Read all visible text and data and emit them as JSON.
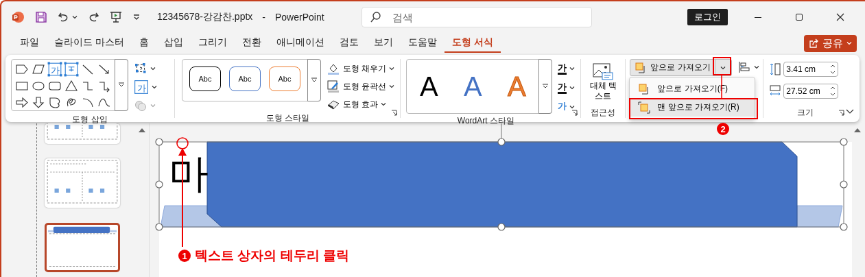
{
  "title_bar": {
    "file_name": "12345678-강감찬.pptx",
    "separator": "-",
    "app_name": "PowerPoint",
    "search": {
      "placeholder": "검색"
    },
    "login": "로그인"
  },
  "tabs": [
    {
      "label": "파일",
      "selected": false
    },
    {
      "label": "슬라이드 마스터",
      "selected": false
    },
    {
      "label": "홈",
      "selected": false
    },
    {
      "label": "삽입",
      "selected": false
    },
    {
      "label": "그리기",
      "selected": false
    },
    {
      "label": "전환",
      "selected": false
    },
    {
      "label": "애니메이션",
      "selected": false
    },
    {
      "label": "검토",
      "selected": false
    },
    {
      "label": "보기",
      "selected": false
    },
    {
      "label": "도움말",
      "selected": false
    },
    {
      "label": "도형 서식",
      "selected": true
    }
  ],
  "share_button": {
    "label": "공유"
  },
  "ribbon": {
    "shape_insert": {
      "label": "도형 삽입",
      "text_box_glyph": "가",
      "edit_glyph": "가"
    },
    "shape_styles": {
      "label": "도형 스타일",
      "presets": [
        {
          "text": "Abc",
          "color": "#000000"
        },
        {
          "text": "Abc",
          "color": "#4472c4"
        },
        {
          "text": "Abc",
          "color": "#ed7d31"
        }
      ],
      "commands": [
        {
          "label": "도형 채우기"
        },
        {
          "label": "도형 윤곽선"
        },
        {
          "label": "도형 효과"
        }
      ]
    },
    "wordart_styles": {
      "label": "WordArt 스타일",
      "presets": [
        {
          "text": "A",
          "color": "#000000"
        },
        {
          "text": "A",
          "color": "#4472c4"
        },
        {
          "text": "A",
          "color": "#ed7d31"
        }
      ],
      "commands": [
        {
          "glyph": "가"
        },
        {
          "glyph": "가"
        },
        {
          "glyph": "가"
        }
      ]
    },
    "accessibility": {
      "label": "접근성",
      "button": "대체 텍스트"
    },
    "arrange": {
      "button": "앞으로 가져오기",
      "menu": [
        {
          "label": "앞으로 가져오기(F)",
          "selected": false
        },
        {
          "label": "맨 앞으로 가져오기(R)",
          "selected": true
        }
      ]
    },
    "size": {
      "label": "크기",
      "height": "3.41 cm",
      "width": "27.52 cm"
    }
  },
  "thumbnails": [
    {
      "selected": false
    },
    {
      "selected": false
    },
    {
      "selected": true
    }
  ],
  "slide": {
    "title_text": "마"
  },
  "annotations": [
    {
      "number": "1",
      "text": "텍스트 상자의 테두리 클릭"
    },
    {
      "number": "2"
    }
  ]
}
